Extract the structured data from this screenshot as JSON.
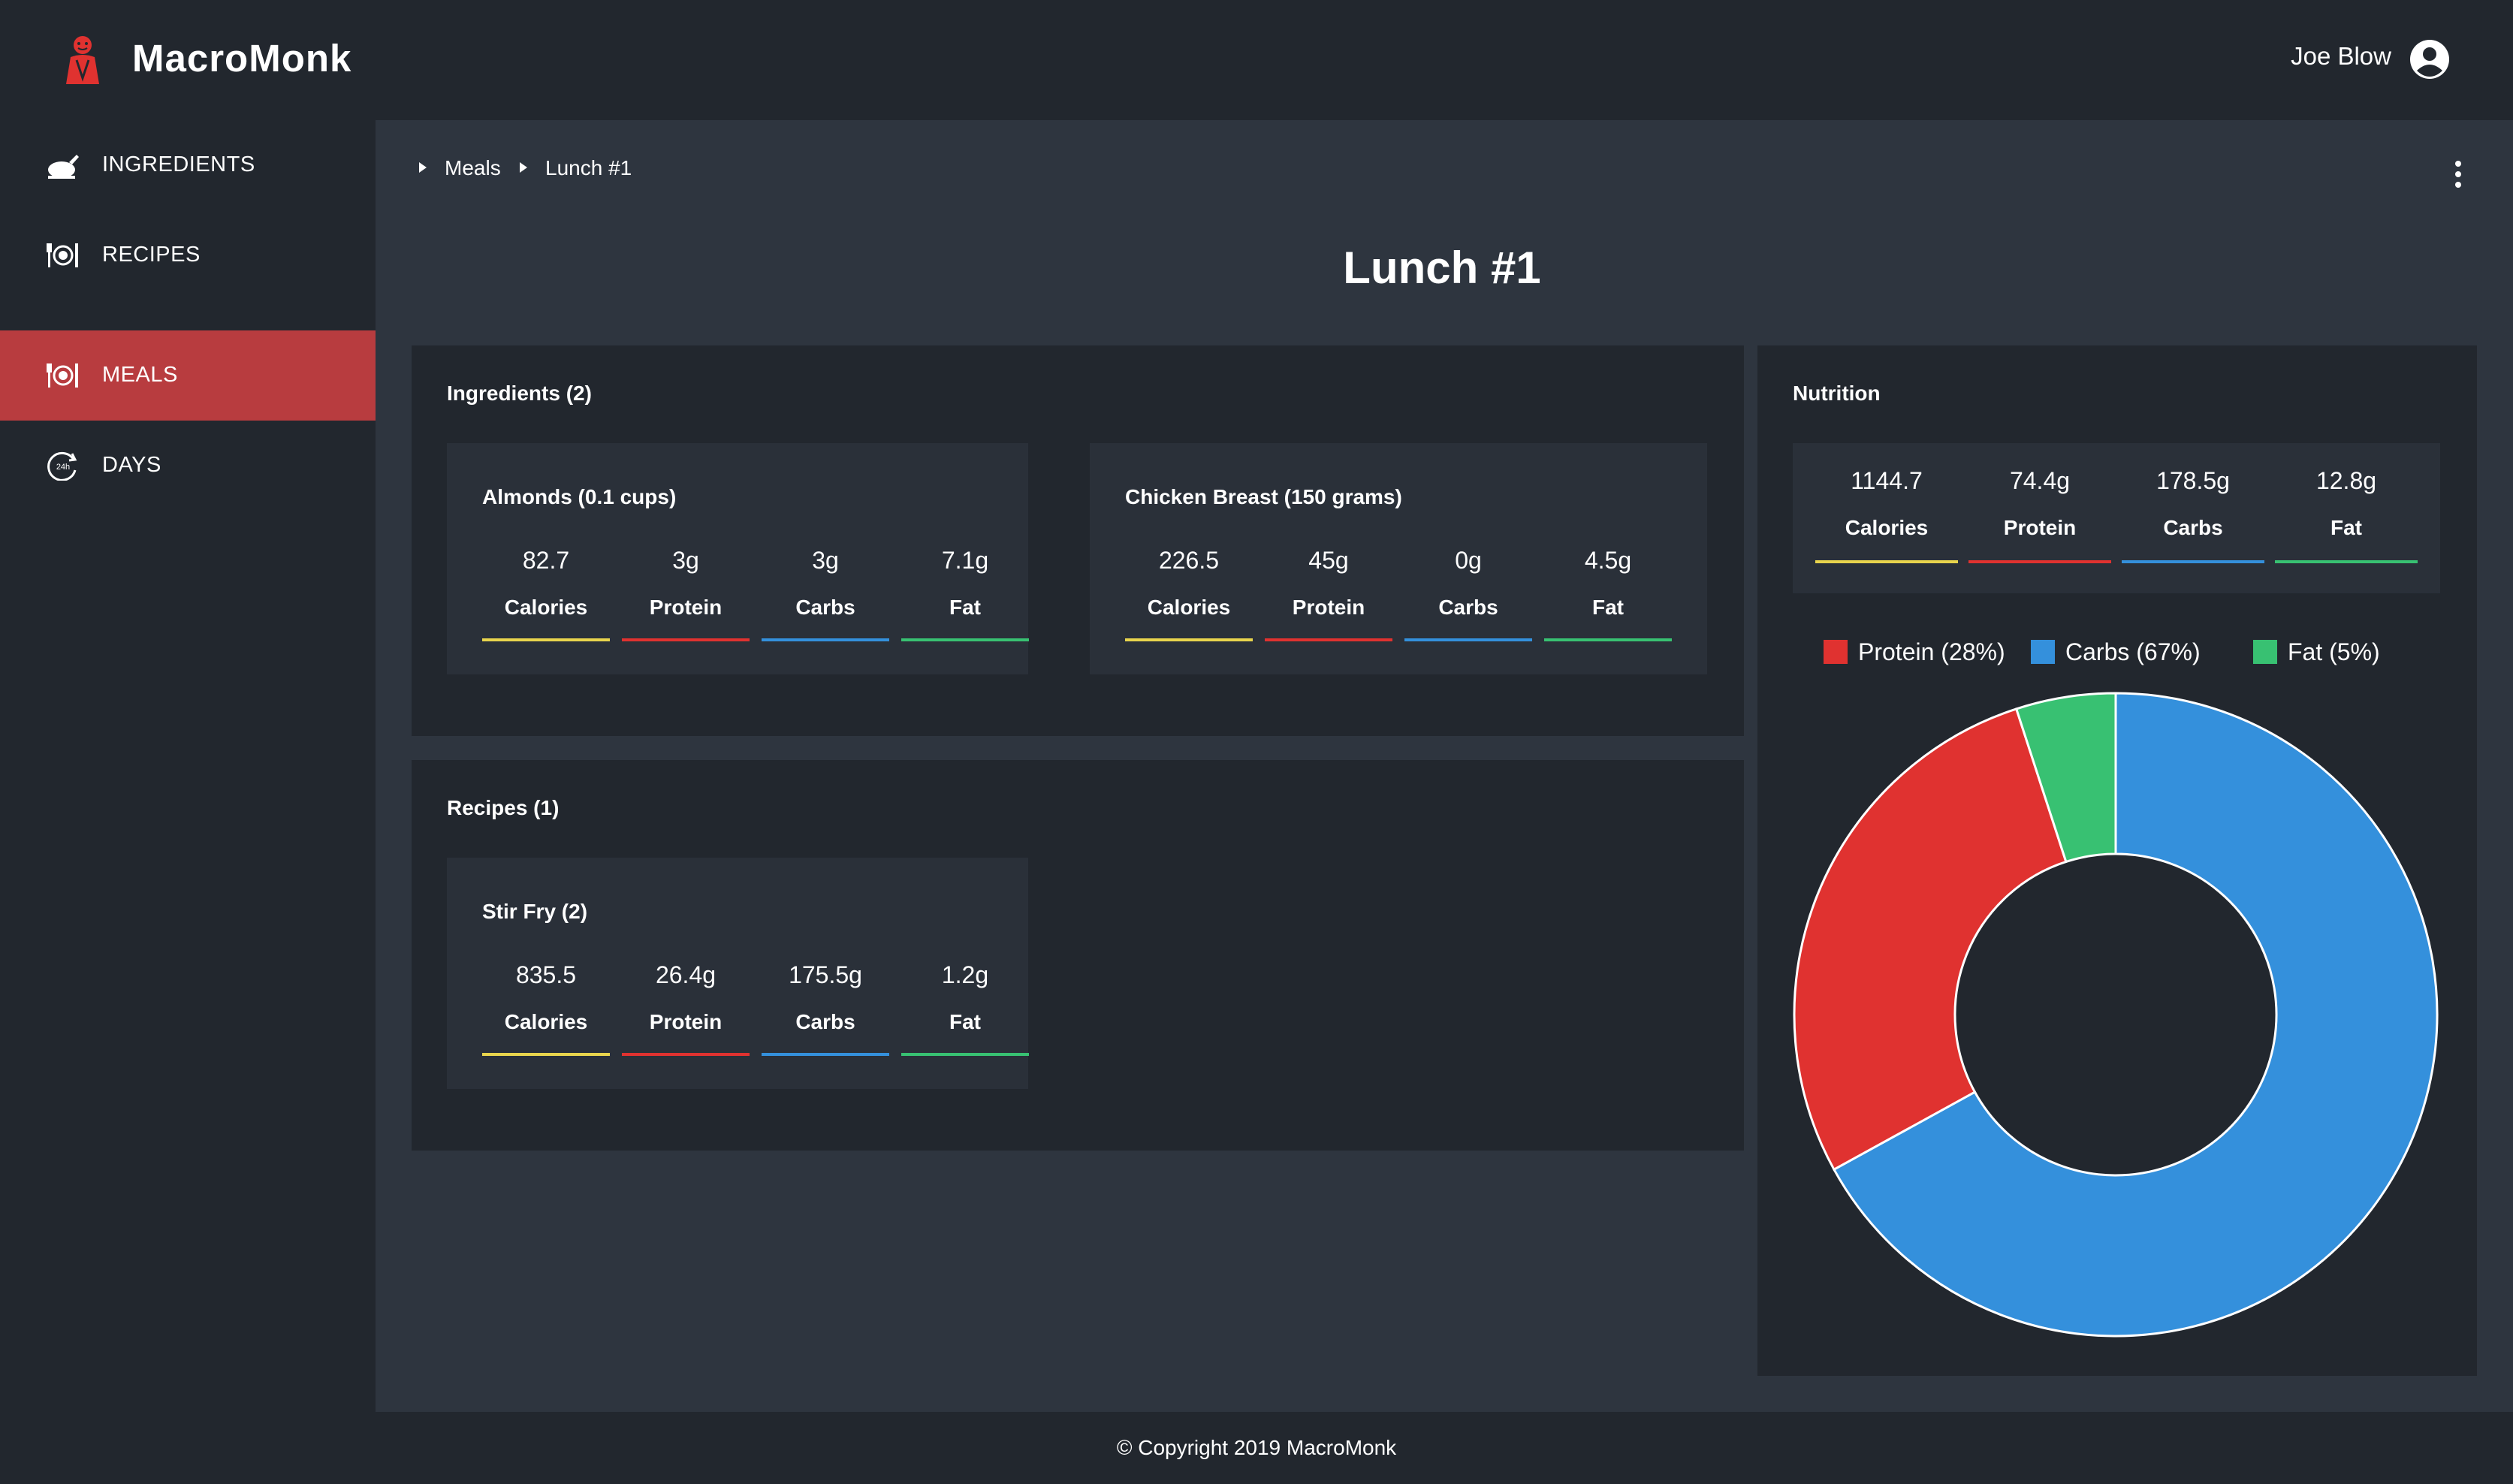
{
  "app": {
    "brand": "MacroMonk"
  },
  "user": {
    "name": "Joe Blow"
  },
  "sidebar": {
    "items": [
      {
        "label": "INGREDIENTS",
        "icon": "chicken-leg-icon"
      },
      {
        "label": "RECIPES",
        "icon": "plate-cutlery-icon"
      },
      {
        "label": "MEALS",
        "icon": "plate-cutlery-icon",
        "active": true
      },
      {
        "label": "DAYS",
        "icon": "24h-clock-icon"
      }
    ]
  },
  "breadcrumb": {
    "items": [
      "Meals",
      "Lunch #1"
    ]
  },
  "page": {
    "title": "Lunch #1"
  },
  "colors": {
    "calories": "#e8d44d",
    "protein": "#e03230",
    "carbs": "#3490dc",
    "fat": "#38c172",
    "active_nav": "#b83c3f"
  },
  "ingredients": {
    "title": "Ingredients (2)",
    "cards": [
      {
        "title": "Almonds (0.1 cups)",
        "stats": [
          {
            "value": "82.7",
            "label": "Calories"
          },
          {
            "value": "3g",
            "label": "Protein"
          },
          {
            "value": "3g",
            "label": "Carbs"
          },
          {
            "value": "7.1g",
            "label": "Fat"
          }
        ]
      },
      {
        "title": "Chicken Breast (150 grams)",
        "stats": [
          {
            "value": "226.5",
            "label": "Calories"
          },
          {
            "value": "45g",
            "label": "Protein"
          },
          {
            "value": "0g",
            "label": "Carbs"
          },
          {
            "value": "4.5g",
            "label": "Fat"
          }
        ]
      }
    ]
  },
  "recipes": {
    "title": "Recipes (1)",
    "cards": [
      {
        "title": "Stir Fry (2)",
        "stats": [
          {
            "value": "835.5",
            "label": "Calories"
          },
          {
            "value": "26.4g",
            "label": "Protein"
          },
          {
            "value": "175.5g",
            "label": "Carbs"
          },
          {
            "value": "1.2g",
            "label": "Fat"
          }
        ]
      }
    ]
  },
  "nutrition": {
    "title": "Nutrition",
    "stats": [
      {
        "value": "1144.7",
        "label": "Calories"
      },
      {
        "value": "74.4g",
        "label": "Protein"
      },
      {
        "value": "178.5g",
        "label": "Carbs"
      },
      {
        "value": "12.8g",
        "label": "Fat"
      }
    ],
    "legend": [
      "Protein (28%)",
      "Carbs (67%)",
      "Fat (5%)"
    ]
  },
  "chart_data": {
    "type": "pie",
    "categories": [
      "Protein",
      "Carbs",
      "Fat"
    ],
    "values": [
      28,
      67,
      5
    ],
    "colors": [
      "#e03230",
      "#3490dc",
      "#38c172"
    ],
    "legend": "top"
  },
  "footer": {
    "text": "© Copyright 2019 MacroMonk"
  }
}
